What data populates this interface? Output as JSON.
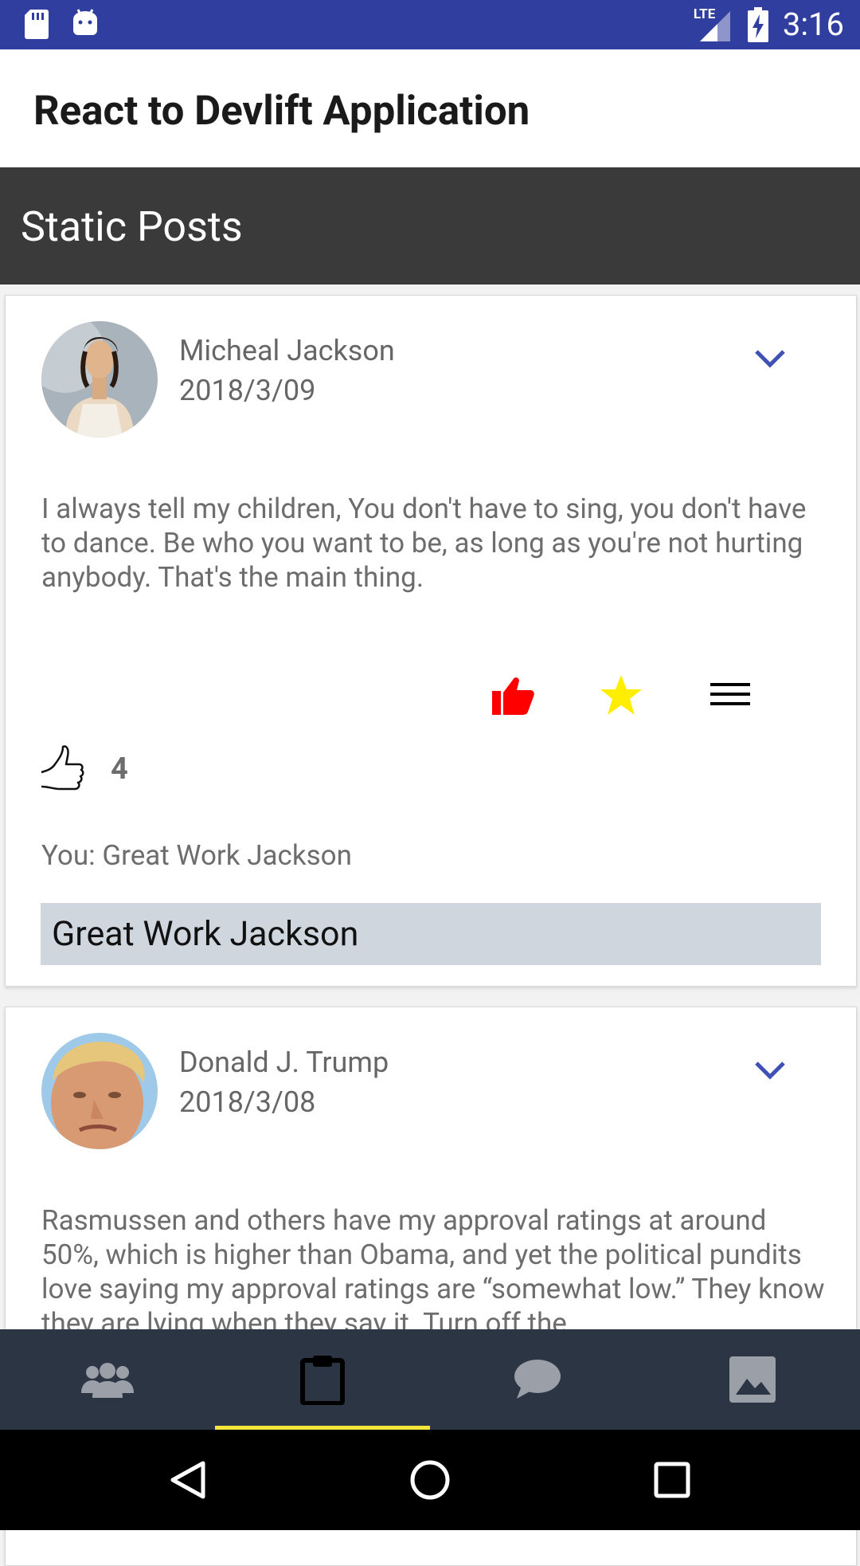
{
  "status_bar": {
    "time": "3:16",
    "network_label": "LTE",
    "icons": [
      "sd-card-icon",
      "android-icon",
      "signal-icon",
      "battery-charging-icon"
    ]
  },
  "app": {
    "title": "React to Devlift Application",
    "section_title": "Static Posts"
  },
  "posts": [
    {
      "author": "Micheal Jackson",
      "date": "2018/3/09",
      "text": "I always tell my children, You don't have to sing, you don't have to dance. Be who you want to be, as long as you're not hurting anybody. That's the main thing.",
      "likes": "4",
      "comment": "You: Great Work Jackson",
      "comment_input_value": "Great Work Jackson",
      "colors": {
        "like": "#ff0000",
        "star": "#ffee00",
        "chevron": "#3f51b5"
      }
    },
    {
      "author": "Donald J. Trump",
      "date": "2018/3/08",
      "text": "Rasmussen and others have my approval ratings at around 50%, which is higher than Obama, and yet the political pundits love saying my approval ratings are “somewhat low.” They know they are lying when they say it. Turn off the"
    }
  ],
  "tabs": [
    {
      "icon": "people-icon",
      "active": false
    },
    {
      "icon": "clipboard-icon",
      "active": true
    },
    {
      "icon": "chat-bubble-icon",
      "active": false
    },
    {
      "icon": "image-icon",
      "active": false
    }
  ],
  "theme": {
    "status_bar": "#303f9f",
    "section_bar": "#3a3a3a",
    "tab_bar": "#2c3544",
    "tab_indicator": "#f5e43b",
    "input_bg": "#d0d6de"
  }
}
